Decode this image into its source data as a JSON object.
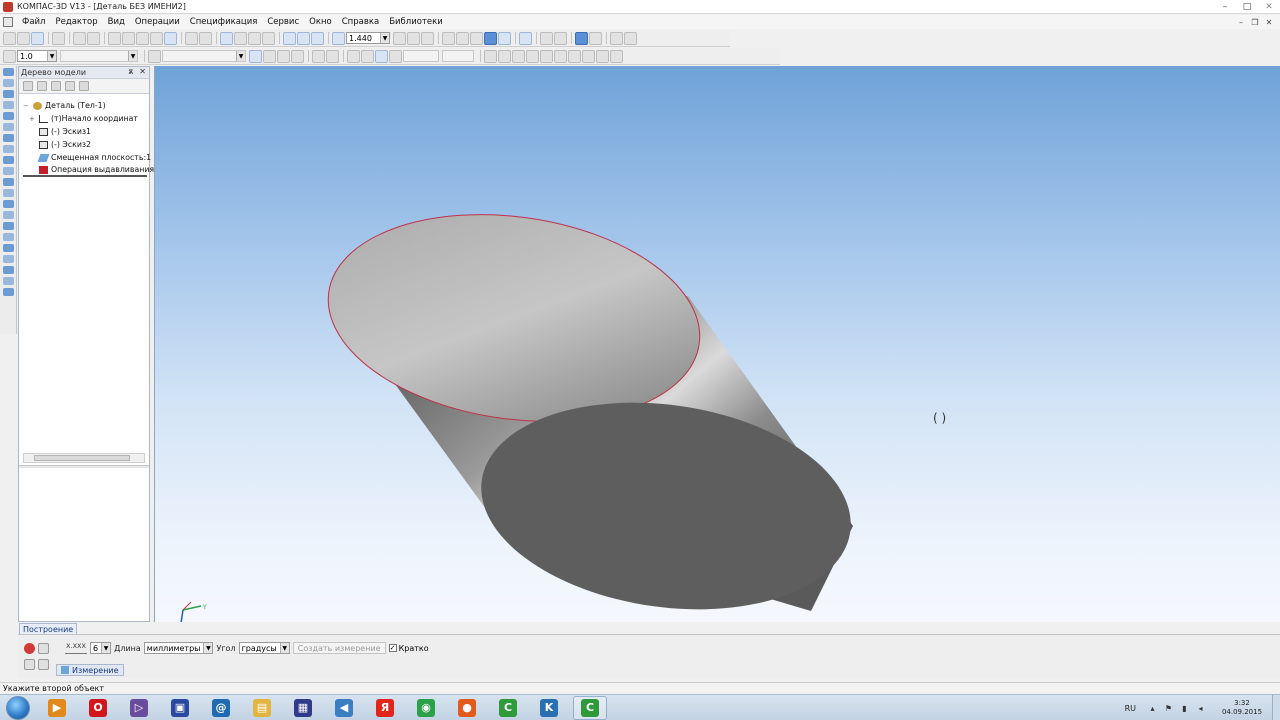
{
  "window": {
    "title": "КОМПАС-3D V13 - [Деталь БЕЗ ИМЕНИ2]",
    "controls": [
      "–",
      "□",
      "✕"
    ]
  },
  "menu": {
    "items": [
      "Файл",
      "Редактор",
      "Вид",
      "Операции",
      "Спецификация",
      "Сервис",
      "Окно",
      "Справка",
      "Библиотеки"
    ],
    "mdi_controls": [
      "–",
      "❐",
      "✕"
    ]
  },
  "toolbar": {
    "zoom_value": "1.440",
    "step_value": "1.0"
  },
  "tree": {
    "title": "Дерево модели",
    "nodes": [
      {
        "label": "Деталь (Тел-1)",
        "icon": "part-icon"
      },
      {
        "label": "(т)Начало координат",
        "icon": "origin-icon"
      },
      {
        "label": "(-) Эскиз1",
        "icon": "sketch-icon"
      },
      {
        "label": "(-) Эскиз2",
        "icon": "sketch-icon"
      },
      {
        "label": "Смещенная плоскость:1",
        "icon": "plane-icon"
      },
      {
        "label": "Операция выдавливания",
        "icon": "extrude-icon"
      }
    ]
  },
  "build_tab": "Построение",
  "properties": {
    "xxx_label": "X.XXX",
    "precision_value": "6",
    "length_label": "Длина",
    "length_unit": "миллиметры",
    "angle_label": "Угол",
    "angle_unit": "градусы",
    "create_button": "Создать измерение",
    "brief_label": "Кратко",
    "brief_checked": "✓",
    "measure_tab": "Измерение"
  },
  "status": {
    "text": "Укажите второй объект"
  },
  "taskbar": {
    "apps": [
      {
        "name": "player-icon",
        "letter": "▶",
        "color": "#e08a1e"
      },
      {
        "name": "opera-icon",
        "letter": "O",
        "color": "#d2161e"
      },
      {
        "name": "visual-studio-icon",
        "letter": "▷",
        "color": "#6a4c9c"
      },
      {
        "name": "save-disk-icon",
        "letter": "▣",
        "color": "#2a4aa0"
      },
      {
        "name": "mail-at-icon",
        "letter": "@",
        "color": "#1f6ab0"
      },
      {
        "name": "folder-icon",
        "letter": "▤",
        "color": "#e2b540"
      },
      {
        "name": "ashampoo-icon",
        "letter": "▦",
        "color": "#303a8a"
      },
      {
        "name": "speaker-icon",
        "letter": "◀",
        "color": "#3a7fc2"
      },
      {
        "name": "yandex-icon",
        "letter": "Я",
        "color": "#e0261a"
      },
      {
        "name": "chrome-icon",
        "letter": "◉",
        "color": "#2aa14a"
      },
      {
        "name": "recorder-icon",
        "letter": "●",
        "color": "#e25a1c"
      },
      {
        "name": "camtasia-icon",
        "letter": "C",
        "color": "#2f9a3a"
      },
      {
        "name": "kompas-icon",
        "letter": "K",
        "color": "#2a6fb0"
      },
      {
        "name": "kompas-active-icon",
        "letter": "C",
        "color": "#2f9a3a"
      }
    ],
    "language": "RU",
    "time": "3:32",
    "date": "04.09.2015"
  }
}
